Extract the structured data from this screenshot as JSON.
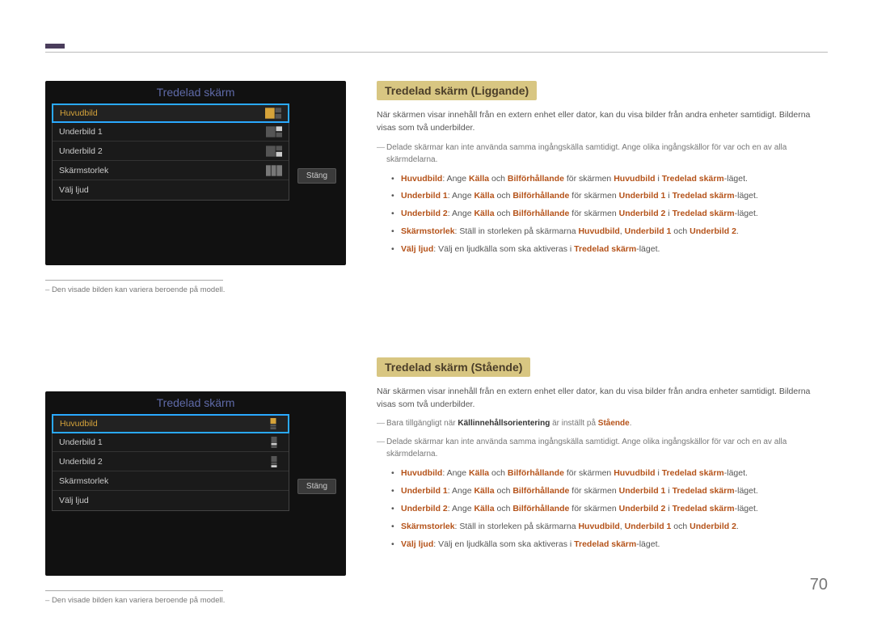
{
  "page_number": "70",
  "osd1": {
    "title": "Tredelad skärm",
    "rows": {
      "r0": "Huvudbild",
      "r1": "Underbild 1",
      "r2": "Underbild 2",
      "r3": "Skärmstorlek",
      "r4": "Välj ljud"
    },
    "close": "Stäng"
  },
  "osd2": {
    "title": "Tredelad skärm",
    "rows": {
      "r0": "Huvudbild",
      "r1": "Underbild 1",
      "r2": "Underbild 2",
      "r3": "Skärmstorlek",
      "r4": "Välj ljud"
    },
    "close": "Stäng"
  },
  "caption_text": "Den visade bilden kan variera beroende på modell.",
  "section1": {
    "heading": "Tredelad skärm (Liggande)",
    "intro": "När skärmen visar innehåll från en extern enhet eller dator, kan du visa bilder från andra enheter samtidigt. Bilderna visas som två underbilder.",
    "note1": "Delade skärmar kan inte använda samma ingångskälla samtidigt. Ange olika ingångskällor för var och en av alla skärmdelarna.",
    "b1_pre": "",
    "b1_hl1": "Huvudbild",
    "b1_mid1": ": Ange ",
    "b1_hl2": "Källa",
    "b1_mid2": " och ",
    "b1_hl3": "Bilförhållande",
    "b1_mid3": " för skärmen ",
    "b1_hl4": "Huvudbild",
    "b1_mid4": " i ",
    "b1_hl5": "Tredelad skärm",
    "b1_end": "-läget.",
    "b2_hl1": "Underbild 1",
    "b2_mid1": ": Ange ",
    "b2_hl2": "Källa",
    "b2_mid2": " och ",
    "b2_hl3": "Bilförhållande",
    "b2_mid3": " för skärmen ",
    "b2_hl4": "Underbild 1",
    "b2_mid4": " i ",
    "b2_hl5": "Tredelad skärm",
    "b2_end": "-läget.",
    "b3_hl1": "Underbild 2",
    "b3_mid1": ": Ange ",
    "b3_hl2": "Källa",
    "b3_mid2": " och ",
    "b3_hl3": "Bilförhållande",
    "b3_mid3": " för skärmen ",
    "b3_hl4": "Underbild 2",
    "b3_mid4": " i ",
    "b3_hl5": "Tredelad skärm",
    "b3_end": "-läget.",
    "b4_hl1": "Skärmstorlek",
    "b4_mid1": ": Ställ in storleken på skärmarna ",
    "b4_hl2": "Huvudbild",
    "b4_mid2": ", ",
    "b4_hl3": "Underbild 1",
    "b4_mid3": " och ",
    "b4_hl4": "Underbild 2",
    "b4_end": ".",
    "b5_hl1": "Välj ljud",
    "b5_mid1": ": Välj en ljudkälla som ska aktiveras i ",
    "b5_hl2": "Tredelad skärm",
    "b5_end": "-läget."
  },
  "section2": {
    "heading": "Tredelad skärm (Stående)",
    "intro": "När skärmen visar innehåll från en extern enhet eller dator, kan du visa bilder från andra enheter samtidigt. Bilderna visas som två underbilder.",
    "note0_pre": "Bara tillgängligt när ",
    "note0_bold": "Källinnehållsorientering",
    "note0_mid": " är inställt på ",
    "note0_hl": "Stående",
    "note0_end": ".",
    "note1": "Delade skärmar kan inte använda samma ingångskälla samtidigt. Ange olika ingångskällor för var och en av alla skärmdelarna."
  }
}
